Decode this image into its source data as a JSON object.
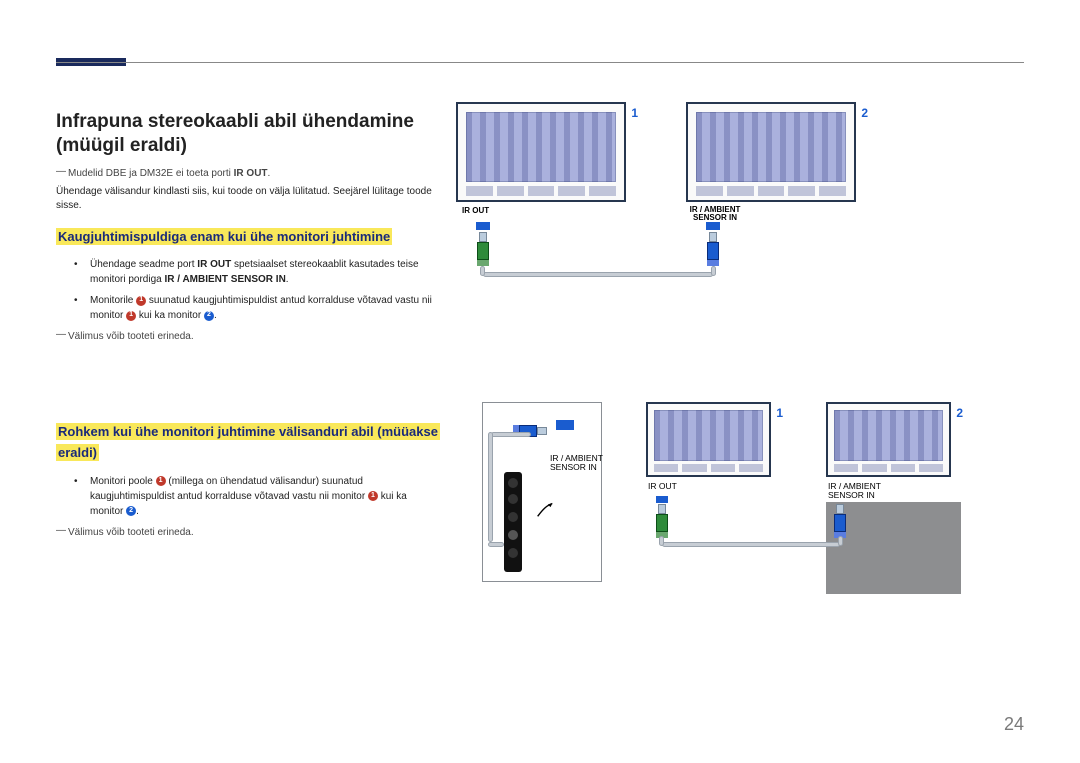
{
  "page_number": "24",
  "main_heading": "Infrapuna stereokaabli abil ühendamine (müügil eraldi)",
  "note_models": {
    "pre": "Mudelid DBE ja DM32E ei toeta porti ",
    "bold": "IR OUT",
    "post": "."
  },
  "intro": "Ühendage välisandur kindlasti siis, kui toode on välja lülitatud. Seejärel lülitage toode sisse.",
  "section1": {
    "heading": "Kaugjuhtimispuldiga enam kui ühe monitori juhtimine",
    "b1a": "Ühendage seadme port ",
    "b1b": "IR OUT",
    "b1c": " spetsiaalset stereokaablit kasutades teise monitori pordiga ",
    "b1d": "IR / AMBIENT SENSOR IN",
    "b1e": ".",
    "b2a": "Monitorile ",
    "b2b": " suunatud kaugjuhtimispuldist antud korralduse võtavad vastu nii monitor ",
    "b2c": " kui ka monitor ",
    "b2d": ".",
    "note": "Välimus võib tooteti erineda."
  },
  "section2": {
    "heading": "Rohkem kui ühe monitori juhtimine välisanduri abil (müüakse eraldi)",
    "b1a": "Monitori poole ",
    "b1b": " (millega on ühendatud välisandur) suunatud kaugjuhtimispuldist antud korralduse võtavad vastu nii monitor ",
    "b1c": " kui ka monitor ",
    "b1d": ".",
    "note": "Välimus võib tooteti erineda."
  },
  "diagram1": {
    "label1": "1",
    "label2": "2",
    "port1": "IR OUT",
    "port2a": "IR / AMBIENT",
    "port2b": "SENSOR IN"
  },
  "diagram2": {
    "label1": "1",
    "label2": "2",
    "port_sensor_a": "IR / AMBIENT",
    "port_sensor_b": "SENSOR IN",
    "port_out": "IR OUT",
    "port_in_a": "IR / AMBIENT",
    "port_in_b": "SENSOR IN"
  },
  "inline_numbers": {
    "one": "1",
    "two": "2"
  }
}
